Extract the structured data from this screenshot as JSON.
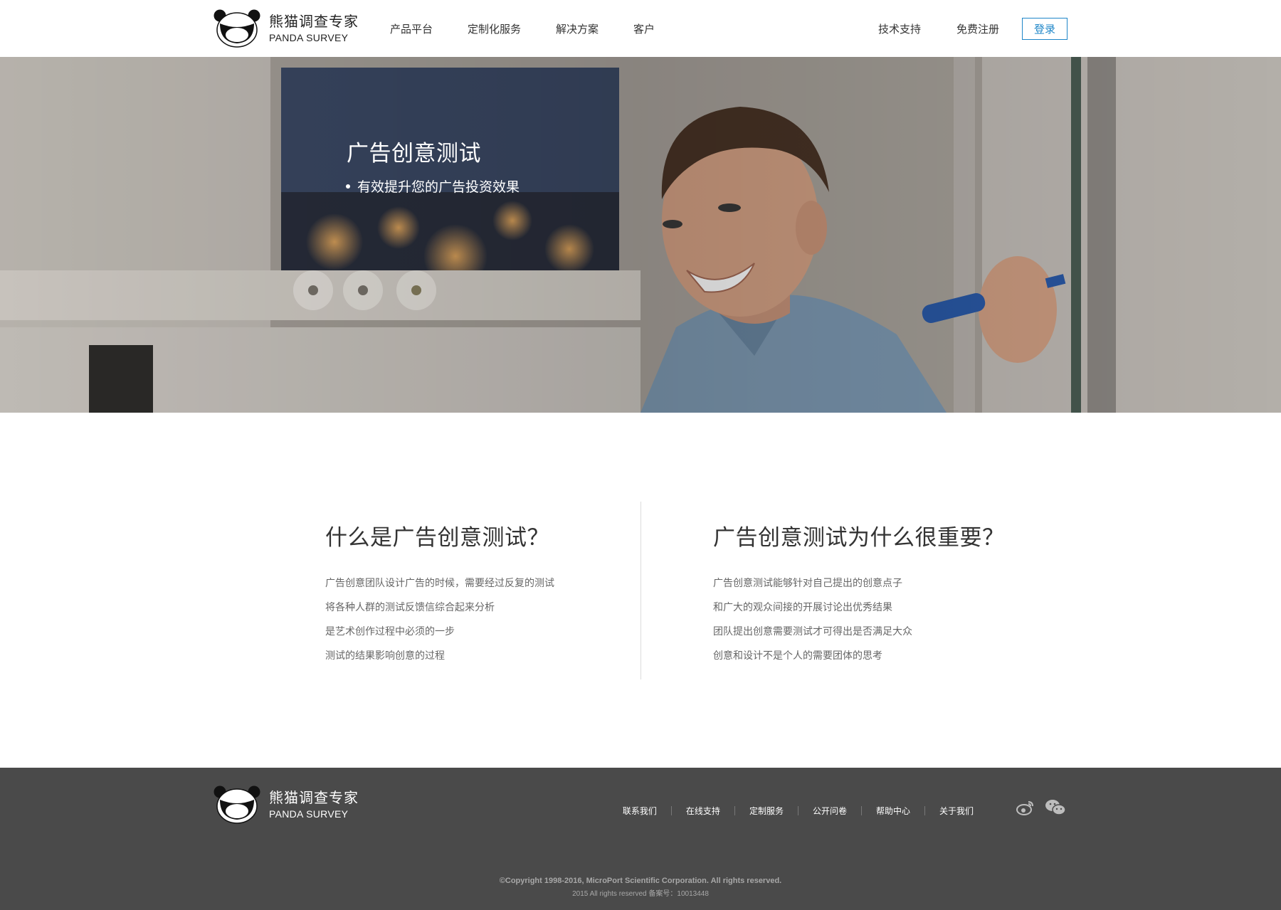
{
  "brand": {
    "name_cn": "熊猫调查专家",
    "name_en": "PANDA SURVEY"
  },
  "nav": {
    "items": [
      "产品平台",
      "定制化服务",
      "解决方案",
      "客户"
    ],
    "right_items": [
      "技术支持",
      "免费注册"
    ],
    "login_label": "登录"
  },
  "hero": {
    "title": "广告创意测试",
    "bullet": "有效提升您的广告投资效果"
  },
  "sections": {
    "left": {
      "title": "什么是广告创意测试？",
      "lines": [
        "广告创意团队设计广告的时候，需要经过反复的测试",
        "将各种人群的测试反馈信综合起来分析",
        "是艺术创作过程中必须的一步",
        "测试的结果影响创意的过程"
      ]
    },
    "right": {
      "title": "广告创意测试为什么很重要？",
      "lines": [
        "广告创意测试能够针对自己提出的创意点子",
        "和广大的观众间接的开展讨论出优秀结果",
        "团队提出创意需要测试才可得出是否满足大众",
        "创意和设计不是个人的需要团体的思考"
      ]
    }
  },
  "footer": {
    "links": [
      "联系我们",
      "在线支持",
      "定制服务",
      "公开问卷",
      "帮助中心",
      "关于我们"
    ],
    "social": [
      "weibo-icon",
      "wechat-icon"
    ],
    "copyright": "©Copyright 1998-2016, MicroPort Scientific Corporation. All rights reserved.",
    "icp": "2015 All rights reserved 备案号：10013448"
  },
  "colors": {
    "accent": "#1e86c8",
    "footer_bg": "#4a4a4a",
    "hero_text": "#ffffff"
  }
}
